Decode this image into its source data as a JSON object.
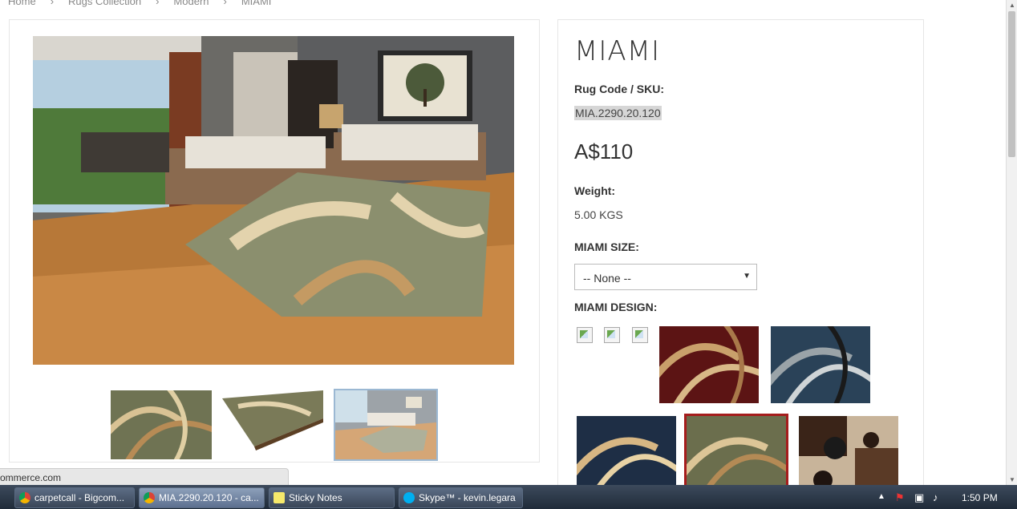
{
  "breadcrumb": [
    "Home",
    "Rugs Collection",
    "Modern",
    "MIAMI"
  ],
  "product": {
    "title": "MIAMI",
    "sku_label": "Rug Code / SKU:",
    "sku": "MIA.2290.20.120",
    "price": "A$110",
    "weight_label": "Weight:",
    "weight": "5.00 KGS",
    "size_label": "MIAMI SIZE:",
    "size_selected": "-- None --",
    "design_label": "MIAMI DESIGN:"
  },
  "status_bar": "ommerce.com",
  "taskbar": {
    "items": [
      "carpetcall - Bigcom...",
      "MIA.2290.20.120 - ca...",
      "Sticky Notes",
      "Skype™ - kevin.legara"
    ],
    "clock": "1:50 PM"
  },
  "colors": {
    "selected_swatch_border": "#a51c1c",
    "active_thumb_border": "#9bb8d3"
  }
}
